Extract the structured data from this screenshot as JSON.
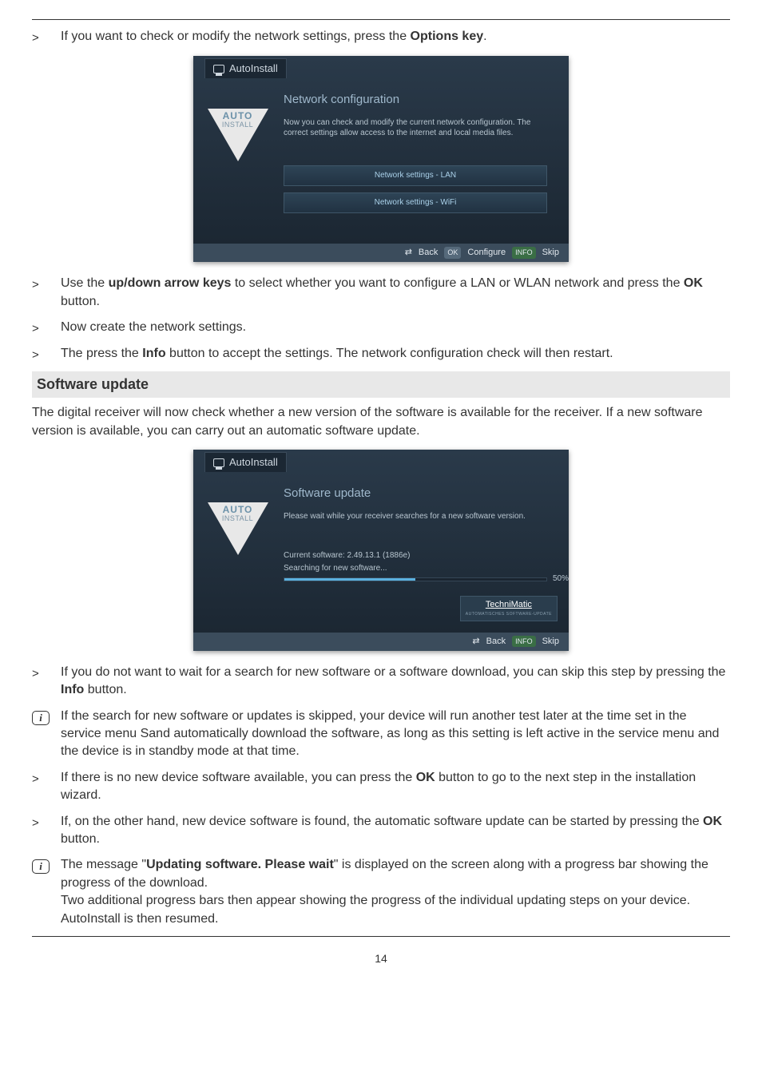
{
  "rows": {
    "r1": {
      "pre": "If you want to check or modify the network settings, press the ",
      "bold": "Options key",
      "post": "."
    },
    "r2": {
      "pre": "Use the ",
      "bold": "up/down arrow keys",
      "mid": " to select whether you want to configure a LAN or WLAN network and press the ",
      "bold2": "OK",
      "post": " button."
    },
    "r3": "Now create the network settings.",
    "r4": {
      "pre": "The press the ",
      "bold": "Info",
      "post": " button to accept the settings. The network configuration check will then restart."
    },
    "r5": {
      "pre": "If you do not want to wait for a search for new software or a software download, you can skip this step by pressing the ",
      "bold": "Info",
      "post": " button."
    },
    "r6": "If the search for new software or updates is skipped, your device will run another test later at the time set in the service menu Sand automatically download the software, as long as this setting is left active in the service menu and the device is in standby mode at that time.",
    "r7": {
      "pre": "If there is no new device software available, you can press the ",
      "bold": "OK",
      "post": " button to go to the next step in the installation wizard."
    },
    "r8": {
      "pre": "If, on the other hand, new device software is found, the automatic software update can be started by pressing the ",
      "bold": "OK",
      "post": " button."
    },
    "r9": {
      "pre": "The message \"",
      "bold": "Updating software. Please wait",
      "post": "\" is displayed on the screen along with a progress bar showing the progress of the download."
    },
    "r9b": "Two additional progress bars then appear showing the progress of the individual updating steps on your device. AutoInstall is then resumed."
  },
  "heading": "Software update",
  "para1": "The digital receiver will now check whether a new version of the software is available for the receiver. If a new software version is available, you can carry out an automatic software update.",
  "shot1": {
    "tab": "AutoInstall",
    "triAuto": "AUTO",
    "triInst": "INSTALL",
    "title": "Network configuration",
    "text": "Now you can check and modify the current network configuration. The correct settings allow access to the internet and local media files.",
    "btn1": "Network settings - LAN",
    "btn2": "Network settings - WiFi",
    "footer": {
      "back": "Back",
      "configure": "Configure",
      "skip": "Skip",
      "ok": "OK",
      "info": "INFO"
    }
  },
  "shot2": {
    "tab": "AutoInstall",
    "triAuto": "AUTO",
    "triInst": "INSTALL",
    "title": "Software update",
    "text": "Please wait while your receiver searches for a new software version.",
    "line1": "Current software: 2.49.13.1 (1886e)",
    "line2": "Searching for new software...",
    "pct": "50%",
    "techni": "TechniMatic",
    "techniSub": "AUTOMATISCHES SOFTWARE-UPDATE",
    "footer": {
      "back": "Back",
      "skip": "Skip",
      "info": "INFO"
    }
  },
  "pageNum": "14",
  "infoGlyph": "i",
  "gt": ">"
}
